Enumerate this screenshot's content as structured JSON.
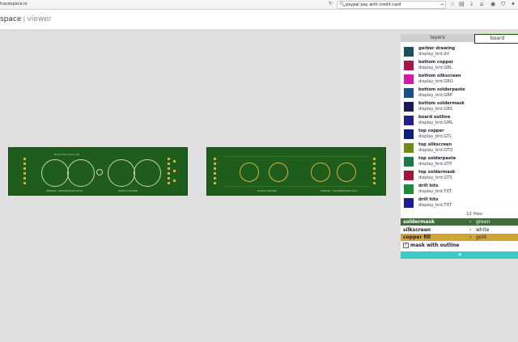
{
  "browser": {
    "url": "tracespace.io",
    "search_text": "paypal pay with credit card"
  },
  "header": {
    "title": "space",
    "separator": "|",
    "subtitle": "viewer"
  },
  "panel": {
    "tabs": [
      {
        "label": "layers"
      },
      {
        "label": "board"
      }
    ],
    "layers": [
      {
        "name": "gerber drawing",
        "file": "display_brd.drl",
        "color": "#1d4f5c"
      },
      {
        "name": "bottom copper",
        "file": "display_brd.GBL",
        "color": "#b0124a"
      },
      {
        "name": "bottom silkscreen",
        "file": "display_brd.GBO",
        "color": "#d21ca8"
      },
      {
        "name": "bottom solderpaste",
        "file": "display_brd.GBP",
        "color": "#1a4f8a"
      },
      {
        "name": "bottom soldermask",
        "file": "display_brd.GBS",
        "color": "#1a1a5a"
      },
      {
        "name": "board outline",
        "file": "display_brd.GML",
        "color": "#23208a"
      },
      {
        "name": "top copper",
        "file": "display_brd.GTL",
        "color": "#0f1f7a"
      },
      {
        "name": "top silkscreen",
        "file": "display_brd.GTO",
        "color": "#6e8b1e"
      },
      {
        "name": "top solderpaste",
        "file": "display_brd.GTP",
        "color": "#1a7a4a"
      },
      {
        "name": "top soldermask",
        "file": "display_brd.GTS",
        "color": "#a0153a"
      },
      {
        "name": "drill hits",
        "file": "display_brd.TXT",
        "color": "#1f8a3a"
      },
      {
        "name": "drill hits",
        "file": "display_brd.TXT",
        "color": "#1a1a9a"
      }
    ],
    "file_count": "12 files",
    "options": [
      {
        "label": "soldermask",
        "value": "green",
        "bg": "#3f6e3a",
        "fg": "#ffffff"
      },
      {
        "label": "silkscreen",
        "value": "white",
        "bg": "#ffffff",
        "fg": "#222222"
      },
      {
        "label": "copper fill",
        "value": "gold",
        "bg": "#d0a534",
        "fg": "#222222"
      }
    ],
    "chevron": "›",
    "mask_label": "mask with outline",
    "mask_checked": "✓",
    "add_label": "+"
  },
  "pcb": {
    "left_label_top": "Nixie Hole Clock v1B",
    "left_label_bottom_a": "SENSOR - PROGRESSIVE 2014",
    "left_label_bottom_b": "DISPLAY BOARD",
    "right_label_a": "DISPLAY BOARD",
    "right_label_b": "SENSOR - PROGRESSIVE 2014"
  },
  "icons": {
    "reload": "↻",
    "search": "🔍",
    "go": "→",
    "star": "☆",
    "reading": "▤",
    "download": "↓",
    "home": "⌂",
    "mask": "◉",
    "shield": "⛉",
    "extension": "✦"
  }
}
